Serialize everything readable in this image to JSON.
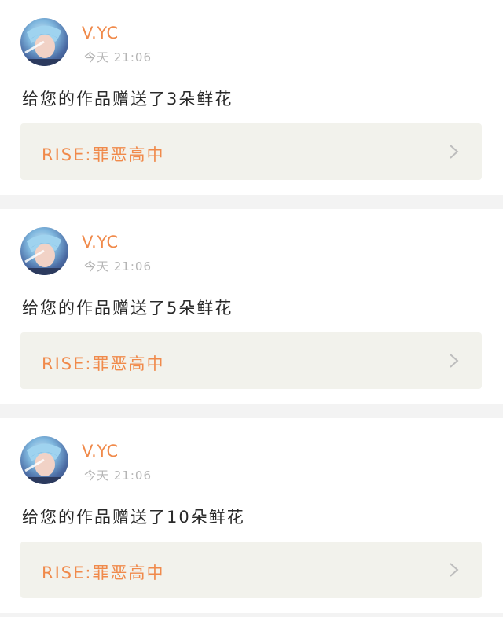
{
  "feed": [
    {
      "username": "V.YC",
      "time": "今天 21:06",
      "message": "给您的作品赠送了3朵鲜花",
      "work_title": "RISE:罪恶高中"
    },
    {
      "username": "V.YC",
      "time": "今天 21:06",
      "message": "给您的作品赠送了5朵鲜花",
      "work_title": "RISE:罪恶高中"
    },
    {
      "username": "V.YC",
      "time": "今天 21:06",
      "message": "给您的作品赠送了10朵鲜花",
      "work_title": "RISE:罪恶高中"
    }
  ],
  "colors": {
    "accent": "#f08a4b",
    "card_link_bg": "#f2f2ec",
    "page_bg": "#f3f3f3",
    "muted_text": "#b5b5b5"
  },
  "icons": {
    "avatar": "user-avatar-image",
    "chevron": "chevron-right-icon"
  }
}
